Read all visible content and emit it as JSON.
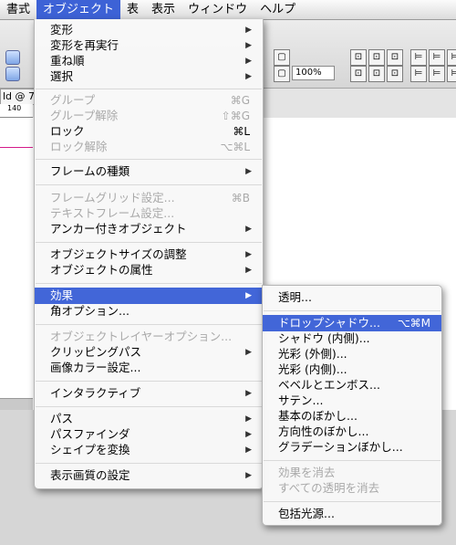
{
  "menubar": {
    "items": [
      "書式",
      "オブジェクト",
      "表",
      "表示",
      "ウィンドウ",
      "ヘルプ"
    ]
  },
  "background": {
    "doc_tab": "ld @ 7",
    "ruler_value": "140",
    "zoom": "100%"
  },
  "menu": {
    "items": [
      {
        "label": "変形",
        "submenu": true
      },
      {
        "label": "変形を再実行",
        "submenu": true
      },
      {
        "label": "重ね順",
        "submenu": true
      },
      {
        "label": "選択",
        "submenu": true
      },
      {
        "label": "グループ",
        "shortcut": "⌘G",
        "disabled": true
      },
      {
        "label": "グループ解除",
        "shortcut": "⇧⌘G",
        "disabled": true
      },
      {
        "label": "ロック",
        "shortcut": "⌘L"
      },
      {
        "label": "ロック解除",
        "shortcut": "⌥⌘L",
        "disabled": true
      },
      {
        "label": "フレームの種類",
        "submenu": true
      },
      {
        "label": "フレームグリッド設定...",
        "shortcut": "⌘B",
        "disabled": true
      },
      {
        "label": "テキストフレーム設定...",
        "disabled": true
      },
      {
        "label": "アンカー付きオブジェクト",
        "submenu": true
      },
      {
        "label": "オブジェクトサイズの調整",
        "submenu": true
      },
      {
        "label": "オブジェクトの属性",
        "submenu": true
      },
      {
        "label": "効果",
        "submenu": true,
        "highlighted": true
      },
      {
        "label": "角オプション..."
      },
      {
        "label": "オブジェクトレイヤーオプション...",
        "disabled": true
      },
      {
        "label": "クリッピングパス",
        "submenu": true
      },
      {
        "label": "画像カラー設定..."
      },
      {
        "label": "インタラクティブ",
        "submenu": true
      },
      {
        "label": "パス",
        "submenu": true
      },
      {
        "label": "パスファインダ",
        "submenu": true
      },
      {
        "label": "シェイプを変換",
        "submenu": true
      },
      {
        "label": "表示画質の設定",
        "submenu": true
      }
    ]
  },
  "submenu": {
    "items": [
      {
        "label": "透明..."
      },
      {
        "label": "ドロップシャドウ...",
        "shortcut": "⌥⌘M",
        "highlighted": true
      },
      {
        "label": "シャドウ (内側)..."
      },
      {
        "label": "光彩 (外側)..."
      },
      {
        "label": "光彩 (内側)..."
      },
      {
        "label": "ベベルとエンボス..."
      },
      {
        "label": "サテン..."
      },
      {
        "label": "基本のぼかし..."
      },
      {
        "label": "方向性のぼかし..."
      },
      {
        "label": "グラデーションぼかし..."
      },
      {
        "label": "効果を消去",
        "disabled": true
      },
      {
        "label": "すべての透明を消去",
        "disabled": true
      },
      {
        "label": "包括光源..."
      }
    ]
  }
}
